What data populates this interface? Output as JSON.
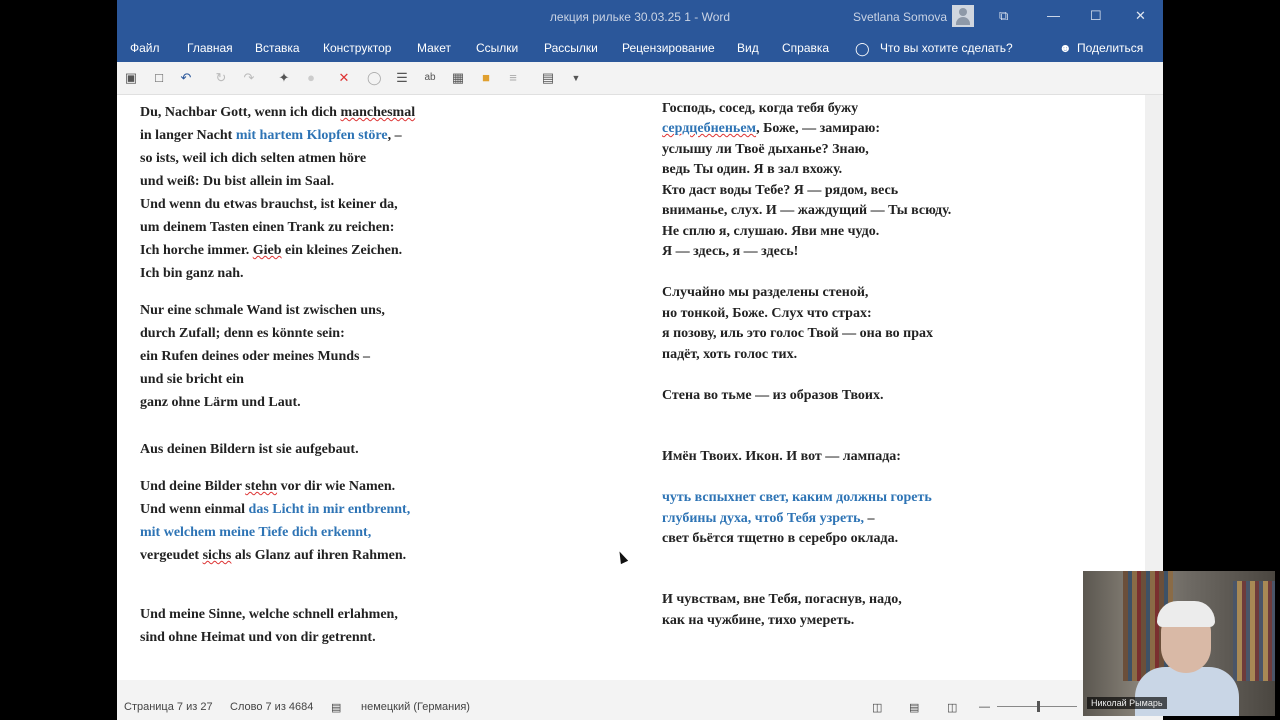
{
  "window": {
    "title": "лекция рильке 30.03.25 1  -  Word",
    "user": "Svetlana Somova",
    "controls": {
      "restore": "⧉",
      "minimize": "—",
      "maximize": "☐",
      "close": "✕"
    }
  },
  "ribbon": {
    "tabs": [
      "Файл",
      "Главная",
      "Вставка",
      "Конструктор",
      "Макет",
      "Ссылки",
      "Рассылки",
      "Рецензирование",
      "Вид",
      "Справка"
    ],
    "tellme": "Что вы хотите сделать?",
    "share": "Поделиться"
  },
  "qat": [
    "save-icon",
    "new-doc-icon",
    "undo-icon",
    "redo-disabled-icon",
    "redo-icon",
    "format-painter-icon",
    "circle-icon",
    "clear-format-icon",
    "shape-icon",
    "list-icon",
    "spell-icon",
    "save-as-icon",
    "open-folder-icon",
    "align-icon",
    "select-icon",
    "customize-icon"
  ],
  "document": {
    "left": [
      [
        {
          "t": "Du, Nachbar Gott, wenn ich dich "
        },
        {
          "t": "manchesmal",
          "sq": true
        }
      ],
      [
        {
          "t": "in langer Nacht "
        },
        {
          "t": "mit hartem Klopfen störe",
          "c": "blue"
        },
        {
          "t": ", –"
        }
      ],
      [
        {
          "t": "so ists, weil ich dich selten atmen höre"
        }
      ],
      [
        {
          "t": "und weiß: Du bist allein im Saal."
        }
      ],
      [
        {
          "t": "Und wenn du etwas brauchst, ist keiner da,"
        }
      ],
      [
        {
          "t": "um deinem Tasten einen Trank zu reichen:"
        }
      ],
      [
        {
          "t": "Ich horche immer. "
        },
        {
          "t": "Gieb",
          "sq": true
        },
        {
          "t": " ein kleines Zeichen."
        }
      ],
      [
        {
          "t": "Ich bin ganz nah."
        }
      ],
      [
        {
          "t": "Nur eine schmale Wand ist zwischen uns,"
        }
      ],
      [
        {
          "t": "durch Zufall; denn es könnte sein:"
        }
      ],
      [
        {
          "t": "ein Rufen deines oder meines Munds –"
        }
      ],
      [
        {
          "t": "und sie bricht ein"
        }
      ],
      [
        {
          "t": "ganz ohne Lärm und Laut."
        }
      ],
      [
        {
          "t": "Aus deinen Bildern ist sie aufgebaut."
        }
      ],
      [
        {
          "t": "Und deine Bilder "
        },
        {
          "t": "stehn",
          "sq": true
        },
        {
          "t": " vor dir wie Namen."
        }
      ],
      [
        {
          "t": "Und wenn einmal "
        },
        {
          "t": "das Licht in mir entbrennt,",
          "c": "blue"
        }
      ],
      [
        {
          "t": "mit welchem meine Tiefe dich erkennt,",
          "c": "blue"
        }
      ],
      [
        {
          "t": "vergeudet "
        },
        {
          "t": "sichs",
          "sq": true
        },
        {
          "t": " als Glanz auf ihren Rahmen."
        }
      ],
      [
        {
          "t": "Und meine Sinne, welche schnell erlahmen,"
        }
      ],
      [
        {
          "t": "sind ohne Heimat und von dir getrennt."
        }
      ]
    ],
    "right": [
      [
        {
          "t": "Господь, сосед, когда тебя бужу"
        }
      ],
      [
        {
          "t": "сердцебненьем",
          "c": "blue",
          "sq": true
        },
        {
          "t": ", Боже, — замираю:"
        }
      ],
      [
        {
          "t": "услышу ли Твоё дыханье? Знаю,"
        }
      ],
      [
        {
          "t": "ведь Ты один. Я в зал вхожу."
        }
      ],
      [
        {
          "t": "Кто даст воды Тебе? Я — рядом, весь"
        }
      ],
      [
        {
          "t": "вниманье, слух. И — жаждущий — Ты всюду."
        }
      ],
      [
        {
          "t": "Не сплю я, слушаю. Яви мне чудо."
        }
      ],
      [
        {
          "t": "Я — здесь, я — здесь!"
        }
      ],
      [
        {
          "t": "Случайно мы разделены стеной,"
        }
      ],
      [
        {
          "t": "но тонкой, Боже. Слух что страх:"
        }
      ],
      [
        {
          "t": "я позову, иль это голос Твой — она во прах"
        }
      ],
      [
        {
          "t": "падёт, хоть голос тих."
        }
      ],
      [
        {
          "t": "Стена во тьме — из образов Твоих."
        }
      ],
      [
        {
          "t": "Имён Твоих. Икон. И вот — лампада:"
        }
      ],
      [
        {
          "t": "чуть вспыхнет свет, каким должны гореть",
          "c": "blue"
        }
      ],
      [
        {
          "t": "глубины духа, чтоб Тебя узреть,",
          "c": "blue"
        },
        {
          "t": " –"
        }
      ],
      [
        {
          "t": "свет бьётся тщетно в серебро оклада."
        }
      ],
      [
        {
          "t": "И чувствам, вне Тебя, погаснув, надо,"
        }
      ],
      [
        {
          "t": "как на чужбине, тихо умереть."
        }
      ]
    ]
  },
  "status": {
    "page": "Страница 7 из 27",
    "words": "Слово 7 из 4684",
    "language": "немецкий (Германия)",
    "zoom_fraction": 0.5
  },
  "camera": {
    "name": "Николай Рымарь"
  },
  "colors": {
    "accent": "#2b579a",
    "blue_text": "#2e74b5",
    "squiggle": "#d33"
  }
}
